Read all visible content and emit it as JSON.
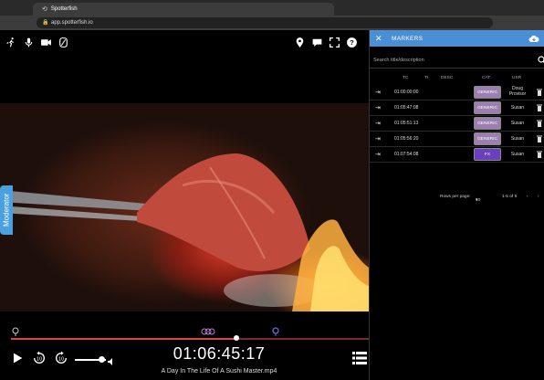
{
  "browser": {
    "tab_title": "Spotterfish",
    "url": "app.spotterfish.io"
  },
  "player": {
    "top_left_icons": [
      "walk-icon",
      "microphone-icon",
      "camera-icon",
      "no-video-icon"
    ],
    "top_right_icons": [
      "location-pin-icon",
      "chat-icon",
      "fullscreen-icon",
      "help-icon"
    ],
    "moderator_label": "Moderator",
    "timecode": "01:06:45:17",
    "filename": "A Day In The Life Of A Sushi Master.mp4",
    "playback_progress": 0.63,
    "volume_level": 0.85,
    "colors": {
      "accent": "#4a8fd6",
      "timeline": "#d44444",
      "marker": "#6b6bd6"
    }
  },
  "markers_panel": {
    "title": "MARKERS",
    "search_placeholder": "Search title/description",
    "columns": [
      "TC",
      "TI.",
      "DESC.",
      "CAT.",
      "USR"
    ],
    "rows": [
      {
        "tc": "01:00:00:00",
        "category": "GENERIC",
        "user": "Doug Provisor",
        "cat_color": "#9b7fb0"
      },
      {
        "tc": "01:05:47:08",
        "category": "GENERIC",
        "user": "Susan",
        "cat_color": "#9b7fb0"
      },
      {
        "tc": "01:05:51:13",
        "category": "GENERIC",
        "user": "Susan",
        "cat_color": "#9b7fb0"
      },
      {
        "tc": "01:05:56:20",
        "category": "GENERIC",
        "user": "Susan",
        "cat_color": "#9b7fb0"
      },
      {
        "tc": "01:07:54:08",
        "category": "FX",
        "user": "Susan",
        "cat_color": "#6a3fc0"
      }
    ],
    "pager": {
      "rows_per_page_label": "Rows per page:",
      "rows_per_page_value": "10",
      "range": "1-5 of 5"
    }
  }
}
